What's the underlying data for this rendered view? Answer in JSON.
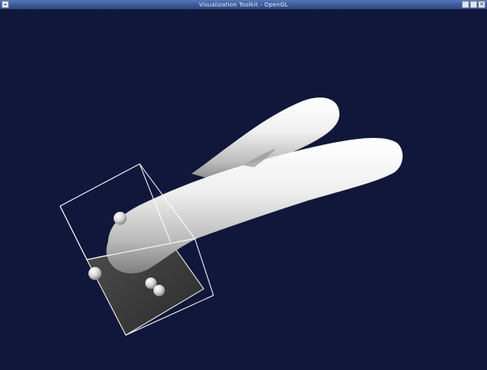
{
  "window": {
    "title": "Visualization Toolkit - OpenGL",
    "controls": {
      "minimize_label": "",
      "maximize_label": "",
      "close_label": "×"
    }
  },
  "scene": {
    "background_color": "#11173a",
    "model": "white-tubular-object",
    "widget": "box-widget",
    "handles_visible": 5
  }
}
